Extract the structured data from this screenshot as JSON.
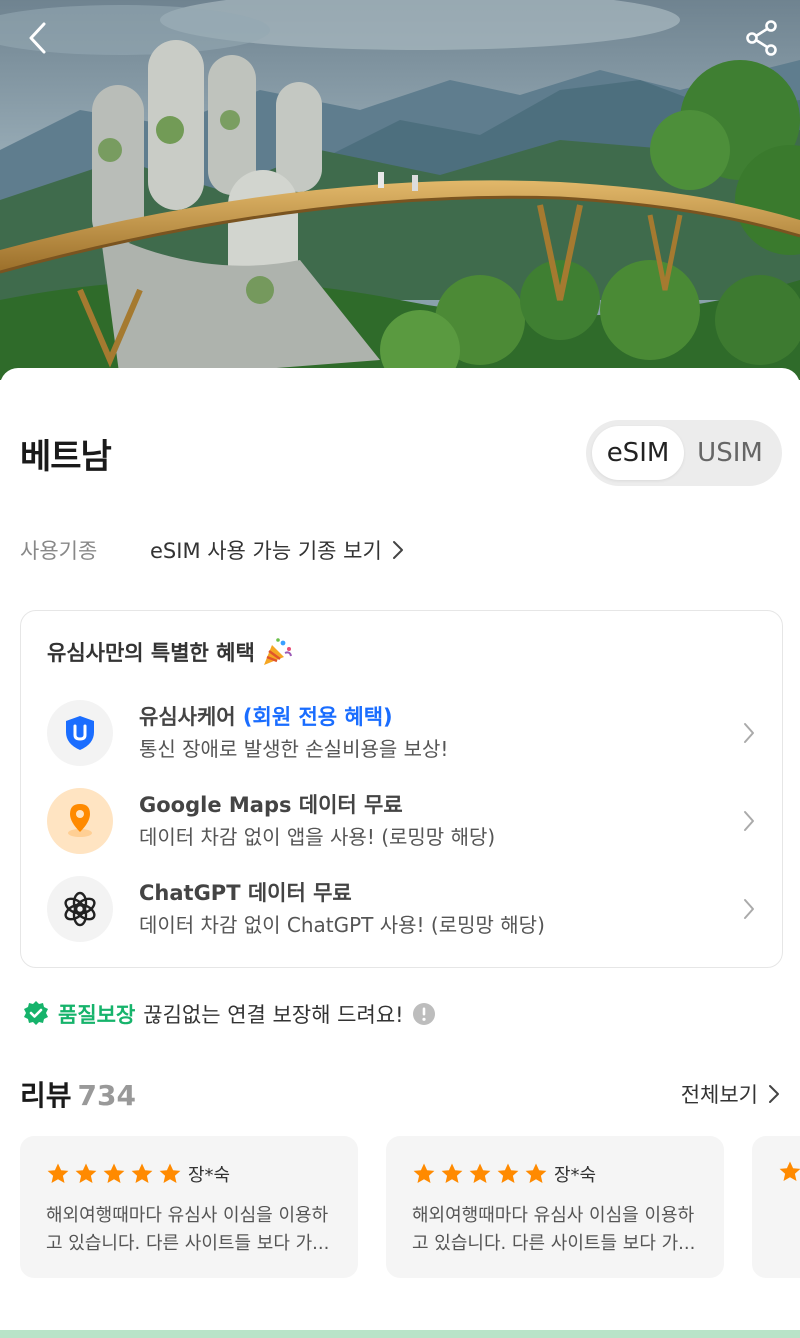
{
  "hero": {
    "back_icon": "chevron-left-icon",
    "share_icon": "share-icon"
  },
  "header": {
    "title": "베트남",
    "sim_options": [
      "eSIM",
      "USIM"
    ],
    "sim_selected": "eSIM"
  },
  "device": {
    "label": "사용기종",
    "link_text": "eSIM 사용 가능 기종 보기"
  },
  "benefits": {
    "heading": "유심사만의 특별한 혜택",
    "heading_emoji": "🎉",
    "items": [
      {
        "title": "유심사케어",
        "title_accent": "(회원 전용 혜택)",
        "subtitle": "통신 장애로 발생한 손실비용을 보상!",
        "icon": "shield-u-icon"
      },
      {
        "title": "Google Maps 데이터 무료",
        "title_accent": "",
        "subtitle": "데이터 차감 없이 앱을 사용! (로밍망 해당)",
        "icon": "map-pin-icon"
      },
      {
        "title": "ChatGPT 데이터 무료",
        "title_accent": "",
        "subtitle": "데이터 차감 없이 ChatGPT 사용! (로밍망 해당)",
        "icon": "chatgpt-icon"
      }
    ]
  },
  "quality": {
    "badge": "품질보장",
    "text": "끊김없는 연결 보장해 드려요!"
  },
  "reviews": {
    "title": "리뷰",
    "count": "734",
    "view_all": "전체보기",
    "items": [
      {
        "rating": 5,
        "reviewer": "장*숙",
        "line1": "해외여행때마다 유심사 이심을 이용하",
        "line2": "고 있습니다. 다른 사이트들 보다 가..."
      },
      {
        "rating": 5,
        "reviewer": "장*숙",
        "line1": "해외여행때마다 유심사 이심을 이용하",
        "line2": "고 있습니다. 다른 사이트들 보다 가..."
      }
    ]
  },
  "colors": {
    "accent_blue": "#1a6dff",
    "quality_green": "#16b36b",
    "star_orange": "#ff8a00"
  }
}
